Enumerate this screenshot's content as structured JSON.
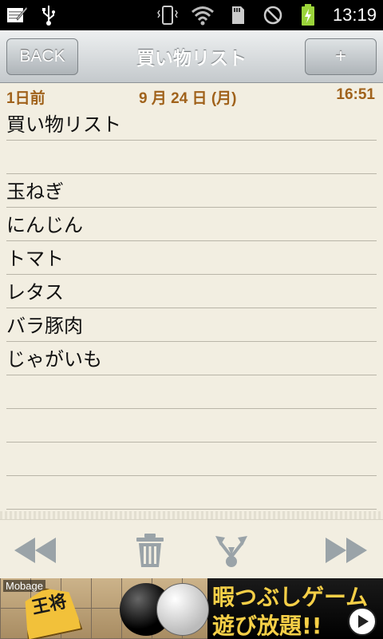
{
  "status_bar": {
    "time": "13:19",
    "icons": [
      "notes-icon",
      "usb-icon",
      "vibrate-icon",
      "wifi-icon",
      "sd-card-icon",
      "no-signal-icon",
      "battery-charging-icon"
    ]
  },
  "header": {
    "back_label": "BACK",
    "title": "買い物リスト",
    "add_label": "+"
  },
  "memo": {
    "relative_day": "1日前",
    "date": "9 月 24 日 (月)",
    "time": "16:51",
    "lines": [
      "買い物リスト",
      "",
      "玉ねぎ",
      "にんじん",
      "トマト",
      "レタス",
      "バラ豚肉",
      "じゃがいも",
      "",
      "",
      "",
      ""
    ]
  },
  "toolbar": {
    "icons": [
      "rewind-icon",
      "trash-icon",
      "share-icon",
      "fast-forward-icon"
    ]
  },
  "ad": {
    "brand": "Mobage",
    "piece_text": "王将",
    "line1": "暇つぶしゲーム",
    "line2": "遊び放題!!"
  },
  "colors": {
    "accent_brown": "#a0621b",
    "paper": "#f2eee1",
    "ad_yellow": "#f6cf47"
  }
}
